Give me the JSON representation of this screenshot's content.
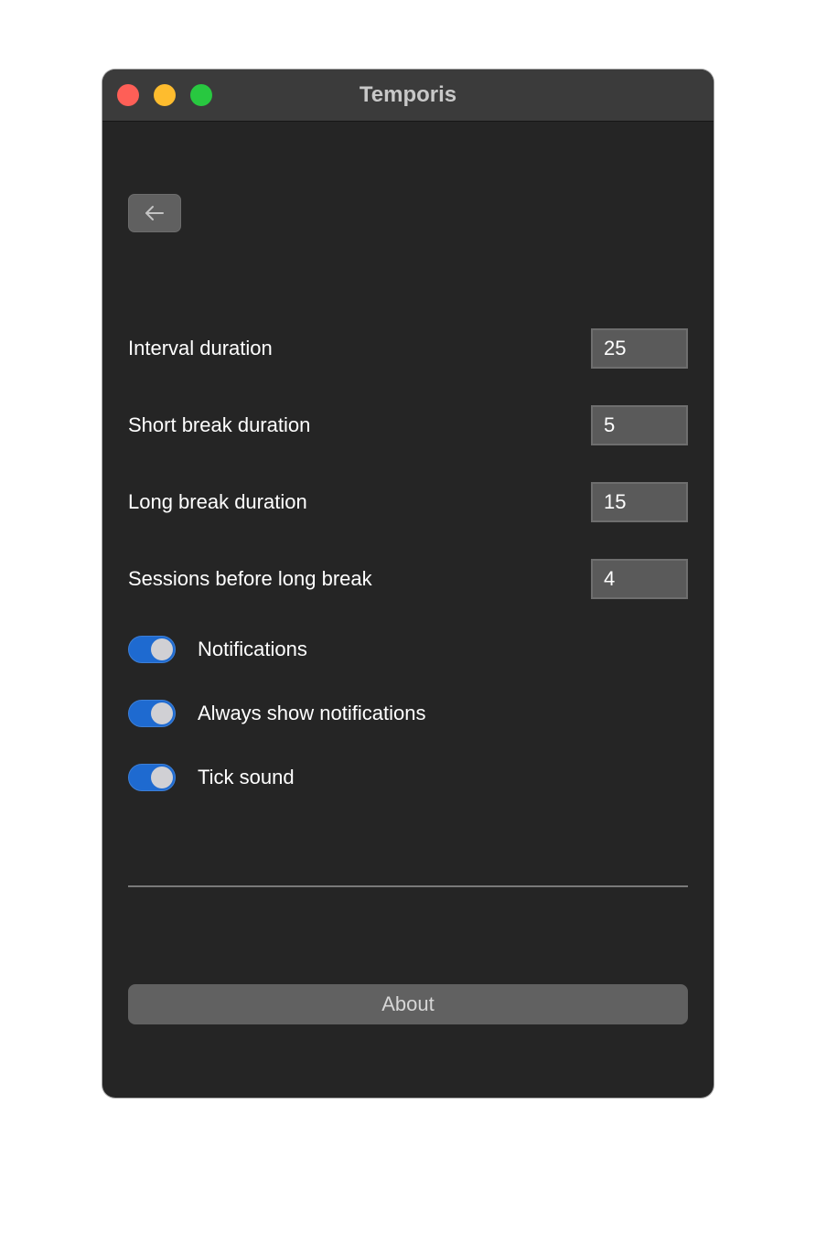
{
  "window": {
    "title": "Temporis",
    "traffic_lights": {
      "close_color": "#fe5f57",
      "minimize_color": "#febc2e",
      "maximize_color": "#28c840"
    }
  },
  "toolbar": {
    "back_icon": "arrow-left-icon"
  },
  "settings": {
    "fields": [
      {
        "label": "Interval duration",
        "value": "25"
      },
      {
        "label": "Short break duration",
        "value": "5"
      },
      {
        "label": "Long break duration",
        "value": "15"
      },
      {
        "label": "Sessions before long break",
        "value": "4"
      }
    ],
    "toggles": [
      {
        "label": "Notifications",
        "on": true
      },
      {
        "label": "Always show notifications",
        "on": true
      },
      {
        "label": "Tick sound",
        "on": true
      }
    ]
  },
  "footer": {
    "about_label": "About"
  },
  "colors": {
    "toggle_on": "#1e6ad0",
    "background": "#252525",
    "titlebar": "#3b3b3b"
  }
}
